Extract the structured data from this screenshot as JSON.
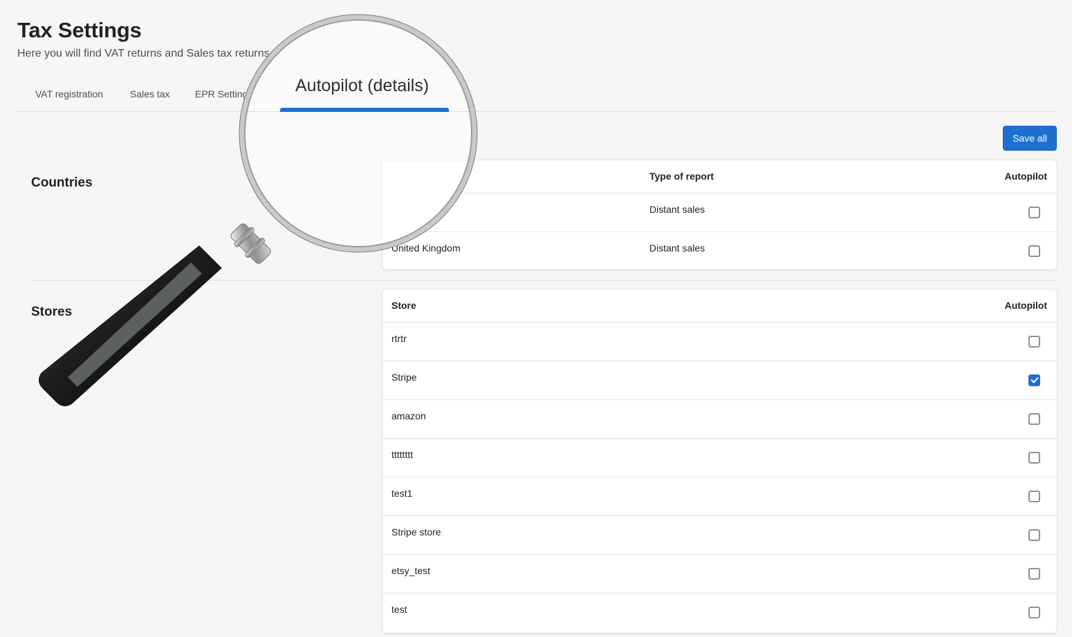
{
  "page": {
    "title": "Tax Settings",
    "subtitle": "Here you will find VAT returns and Sales tax returns se"
  },
  "tabs": [
    {
      "label": "VAT registration"
    },
    {
      "label": "Sales tax"
    },
    {
      "label": "EPR Setting"
    },
    {
      "label": "Autopilot (details)",
      "active": true
    }
  ],
  "toolbar": {
    "save_label": "Save all"
  },
  "countries": {
    "section_title": "Countries",
    "headers": {
      "type": "Type of report",
      "autopilot": "Autopilot"
    },
    "rows": [
      {
        "country": "",
        "type": "Distant sales",
        "autopilot": false
      },
      {
        "country": "United Kingdom",
        "type": "Distant sales",
        "autopilot": false
      }
    ]
  },
  "stores": {
    "section_title": "Stores",
    "headers": {
      "store": "Store",
      "autopilot": "Autopilot"
    },
    "rows": [
      {
        "store": "rtrtr",
        "autopilot": false
      },
      {
        "store": "Stripe",
        "autopilot": true
      },
      {
        "store": "amazon",
        "autopilot": false
      },
      {
        "store": "tttttttt",
        "autopilot": false
      },
      {
        "store": "test1",
        "autopilot": false
      },
      {
        "store": "Stripe store",
        "autopilot": false
      },
      {
        "store": "etsy_test",
        "autopilot": false
      },
      {
        "store": "test",
        "autopilot": false
      }
    ]
  },
  "colors": {
    "accent": "#1f6fd1",
    "background": "#f6f6f7"
  }
}
